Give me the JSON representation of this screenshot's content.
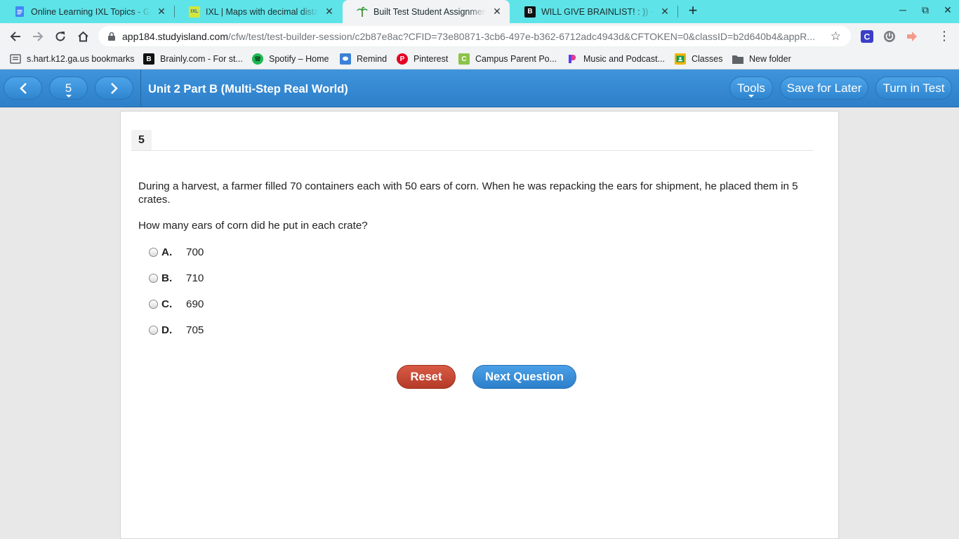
{
  "browser": {
    "tabs": [
      {
        "title": "Online Learning IXL Topics - Goo",
        "icon": "docs-icon",
        "active": false
      },
      {
        "title": "IXL | Maps with decimal distance",
        "icon": "ixl-icon",
        "active": false
      },
      {
        "title": "Built Test Student Assignment - S",
        "icon": "studyisland-icon",
        "active": true
      },
      {
        "title": "WILL GIVE BRAINLIST! : )) - Brainly",
        "icon": "brainly-icon",
        "active": false
      }
    ],
    "new_tab": "+",
    "window_controls": {
      "minimize": "─",
      "restore": "⧉",
      "close": "✕"
    },
    "url_domain": "app184.studyisland.com",
    "url_path": "/cfw/test/test-builder-session/c2b87e8ac?CFID=73e80871-3cb6-497e-b362-6712adc4943d&CFTOKEN=0&classID=b2d640b4&appR...",
    "bookmarks": [
      {
        "label": "s.hart.k12.ga.us bookmarks",
        "icon": "bookmarks-import-icon"
      },
      {
        "label": "Brainly.com - For st...",
        "icon": "brainly-icon"
      },
      {
        "label": "Spotify – Home",
        "icon": "spotify-icon"
      },
      {
        "label": "Remind",
        "icon": "remind-icon"
      },
      {
        "label": "Pinterest",
        "icon": "pinterest-icon"
      },
      {
        "label": "Campus Parent Po...",
        "icon": "campus-icon"
      },
      {
        "label": "Music and Podcast...",
        "icon": "pandora-icon"
      },
      {
        "label": "Classes",
        "icon": "classroom-icon"
      },
      {
        "label": "New folder",
        "icon": "folder-icon"
      }
    ],
    "colors": {
      "tabbar": "#5ee3e8",
      "toolbar": "#f1f3f4"
    }
  },
  "app": {
    "question_selector": "5",
    "assignment_title": "Unit 2 Part B (Multi-Step Real World)",
    "tools_label": "Tools",
    "save_label": "Save for Later",
    "turn_in_label": "Turn in Test",
    "colors": {
      "header": "#3a8fd8",
      "reset": "#c6492f",
      "next": "#3a8fd8"
    }
  },
  "question": {
    "number": "5",
    "stem": "During a harvest, a farmer filled 70 containers each with 50 ears of corn. When he was repacking the ears for shipment, he placed them in 5 crates.",
    "prompt": "How many ears of corn did he put in each crate?",
    "choices": [
      {
        "letter": "A.",
        "value": "700"
      },
      {
        "letter": "B.",
        "value": "710"
      },
      {
        "letter": "C.",
        "value": "690"
      },
      {
        "letter": "D.",
        "value": "705"
      }
    ],
    "reset_label": "Reset",
    "next_label": "Next Question"
  }
}
